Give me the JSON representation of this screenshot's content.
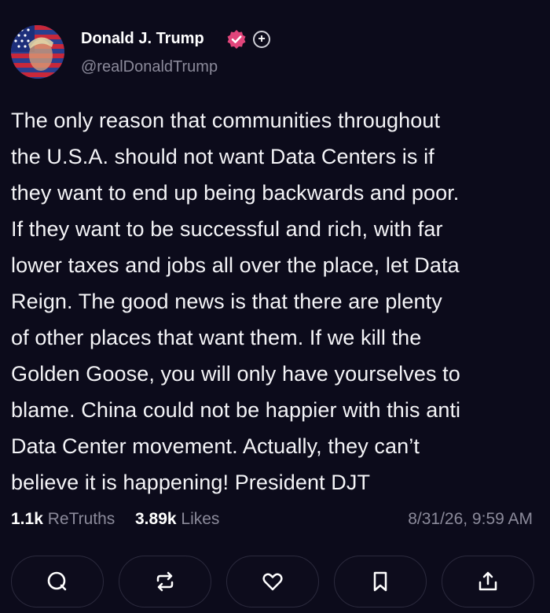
{
  "author": {
    "display_name": "Donald J. Trump",
    "handle": "@realDonaldTrump",
    "avatar_icon": "avatar-flag-portrait",
    "verified_icon": "verified-badge-icon",
    "verified_color": "#e0457b",
    "follow_symbol": "+"
  },
  "post": {
    "lines": [
      "The only reason that communities throughout",
      "the U.S.A. should not want Data Centers is if",
      "they want to end up being backwards and poor.",
      "If they want to be successful and rich, with far",
      "lower taxes and jobs all over the place, let Data",
      "Reign. The good news is that there are plenty",
      "of other places that want them. If we kill the",
      "Golden Goose, you will only have yourselves to",
      "blame. China could not be happier with this anti",
      "Data Center movement. Actually, they can’t",
      "believe it is happening! President DJT"
    ]
  },
  "stats": {
    "retruths_count": "1.1k",
    "retruths_label": "ReTruths",
    "likes_count": "3.89k",
    "likes_label": "Likes",
    "timestamp": "8/31/26, 9:59 AM"
  },
  "actions": [
    {
      "name": "reply",
      "icon": "reply-icon"
    },
    {
      "name": "retruth",
      "icon": "retruth-icon"
    },
    {
      "name": "like",
      "icon": "heart-icon"
    },
    {
      "name": "bookmark",
      "icon": "bookmark-icon"
    },
    {
      "name": "share",
      "icon": "share-icon"
    }
  ],
  "colors": {
    "background": "#0c0b1b",
    "text": "#f4f4f7",
    "muted": "#8b8a9a",
    "button_border": "#2b2a3d"
  }
}
